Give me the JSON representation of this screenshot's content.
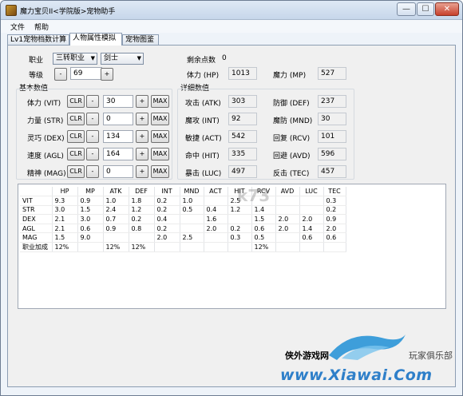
{
  "window": {
    "title": "魔力宝贝II<学院版>宠物助手",
    "buttons": {
      "minimize": "—",
      "maximize": "☐",
      "close": "✕"
    }
  },
  "menu": [
    "文件",
    "帮助"
  ],
  "tabs": [
    "Lv1宠物档数计算",
    "人物属性模拟",
    "宠物图鉴"
  ],
  "active_tab": 1,
  "job": {
    "label": "职业",
    "rank": "三转职业",
    "class": "剑士"
  },
  "level": {
    "label": "等级",
    "value": "69",
    "minus": "-",
    "plus": "+"
  },
  "remaining": {
    "label": "剩余点数",
    "value": "0"
  },
  "hp": {
    "label": "体力 (HP)",
    "value": "1013"
  },
  "mp": {
    "label": "魔力 (MP)",
    "value": "527"
  },
  "base": {
    "title": "基本数值",
    "clr": "CLR",
    "minus": "-",
    "plus": "+",
    "max": "MAX",
    "stats": [
      {
        "label": "体力 (VIT)",
        "value": "30"
      },
      {
        "label": "力量 (STR)",
        "value": "0"
      },
      {
        "label": "灵巧 (DEX)",
        "value": "134"
      },
      {
        "label": "速度 (AGL)",
        "value": "164"
      },
      {
        "label": "精神 (MAG)",
        "value": "0"
      }
    ]
  },
  "detail": {
    "title": "详细数值",
    "left": [
      {
        "label": "攻击 (ATK)",
        "value": "303"
      },
      {
        "label": "魔攻 (INT)",
        "value": "92"
      },
      {
        "label": "敏捷 (ACT)",
        "value": "542"
      },
      {
        "label": "命中 (HIT)",
        "value": "335"
      },
      {
        "label": "暴击 (LUC)",
        "value": "497"
      }
    ],
    "right": [
      {
        "label": "防御 (DEF)",
        "value": "237"
      },
      {
        "label": "魔防 (MND)",
        "value": "30"
      },
      {
        "label": "回复 (RCV)",
        "value": "101"
      },
      {
        "label": "回避 (AVD)",
        "value": "596"
      },
      {
        "label": "反击 (TEC)",
        "value": "457"
      }
    ]
  },
  "table": {
    "headers": [
      "",
      "HP",
      "MP",
      "ATK",
      "DEF",
      "INT",
      "MND",
      "ACT",
      "HIT",
      "RCV",
      "AVD",
      "LUC",
      "TEC"
    ],
    "rows": [
      [
        "VIT",
        "9.3",
        "0.9",
        "1.0",
        "1.8",
        "0.2",
        "1.0",
        "",
        "2.5",
        "",
        "",
        "",
        "0.3"
      ],
      [
        "STR",
        "3.0",
        "1.5",
        "2.4",
        "1.2",
        "0.2",
        "0.5",
        "0.4",
        "1.2",
        "1.4",
        "",
        "",
        "0.2"
      ],
      [
        "DEX",
        "2.1",
        "3.0",
        "0.7",
        "0.2",
        "0.4",
        "",
        "1.6",
        "",
        "1.5",
        "2.0",
        "2.0",
        "0.9"
      ],
      [
        "AGL",
        "2.1",
        "0.6",
        "0.9",
        "0.8",
        "0.2",
        "",
        "2.0",
        "0.2",
        "0.6",
        "2.0",
        "1.4",
        "2.0"
      ],
      [
        "MAG",
        "1.5",
        "9.0",
        "",
        "",
        "2.0",
        "2.5",
        "",
        "0.3",
        "0.5",
        "",
        "0.6",
        "0.6"
      ],
      [
        "职业加成",
        "12%",
        "",
        "12%",
        "12%",
        "",
        "",
        "",
        "",
        "12%",
        "",
        "",
        ""
      ]
    ]
  },
  "watermark": {
    "mid": "k73",
    "site_cn": "侠外游戏网",
    "club": "玩家俱乐部",
    "url": "www.Xiawai.Com"
  },
  "colors": {
    "window_border": "#6d7d92",
    "titlebar": "#c6d6ea",
    "close": "#c7402c",
    "url_blue": "#2e7fc9"
  }
}
